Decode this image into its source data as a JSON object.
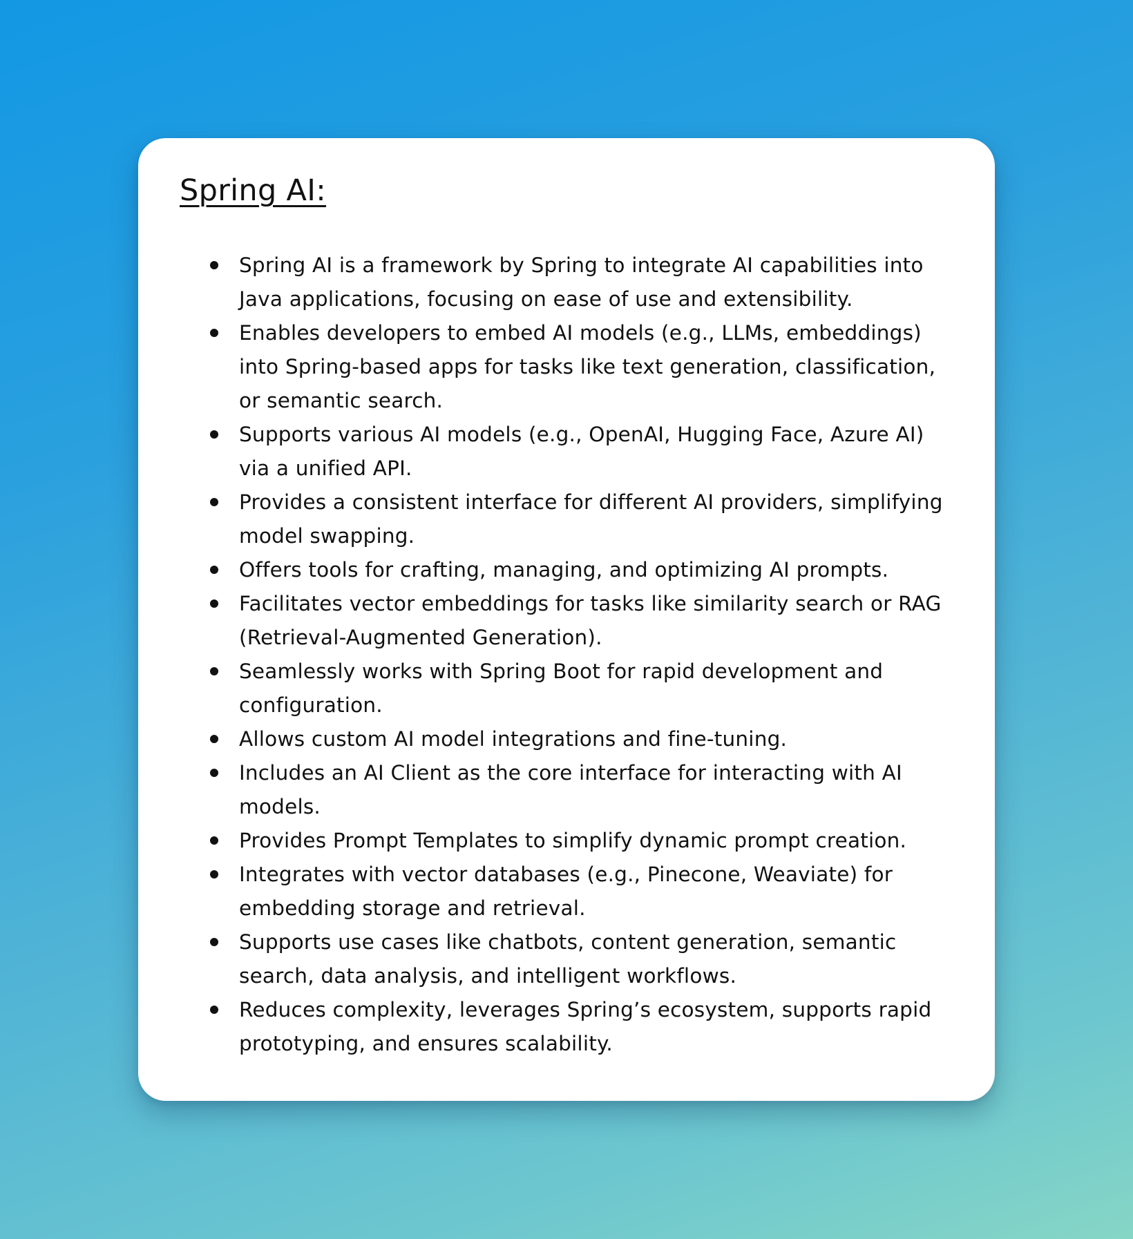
{
  "card": {
    "title": "Spring AI:",
    "bullets": [
      "Spring AI is a framework by Spring to integrate AI capabilities into Java applications, focusing on ease of use and extensibility.",
      "Enables developers to embed AI models (e.g., LLMs, embeddings) into Spring-based apps for tasks like text generation, classification, or semantic search.",
      "Supports various AI models (e.g., OpenAI, Hugging Face, Azure AI) via a unified API.",
      "Provides a consistent interface for different AI providers, simplifying model swapping.",
      "Offers tools for crafting, managing, and optimizing AI prompts.",
      "Facilitates vector embeddings for tasks like similarity search or RAG (Retrieval-Augmented Generation).",
      "Seamlessly works with Spring Boot for rapid development and configuration.",
      "Allows custom AI model integrations and fine-tuning.",
      "Includes an AI Client as the core interface for interacting with AI models.",
      "Provides Prompt Templates to simplify dynamic prompt creation.",
      "Integrates with vector databases (e.g., Pinecone, Weaviate) for embedding storage and retrieval.",
      "Supports use cases like chatbots, content generation, semantic search, data analysis, and intelligent workflows.",
      "Reduces complexity, leverages Spring’s ecosystem, supports rapid prototyping, and ensures scalability."
    ]
  },
  "colors": {
    "background_top": "#1398e4",
    "background_bottom": "#86d6c6",
    "card": "#ffffff",
    "text": "#111111"
  }
}
